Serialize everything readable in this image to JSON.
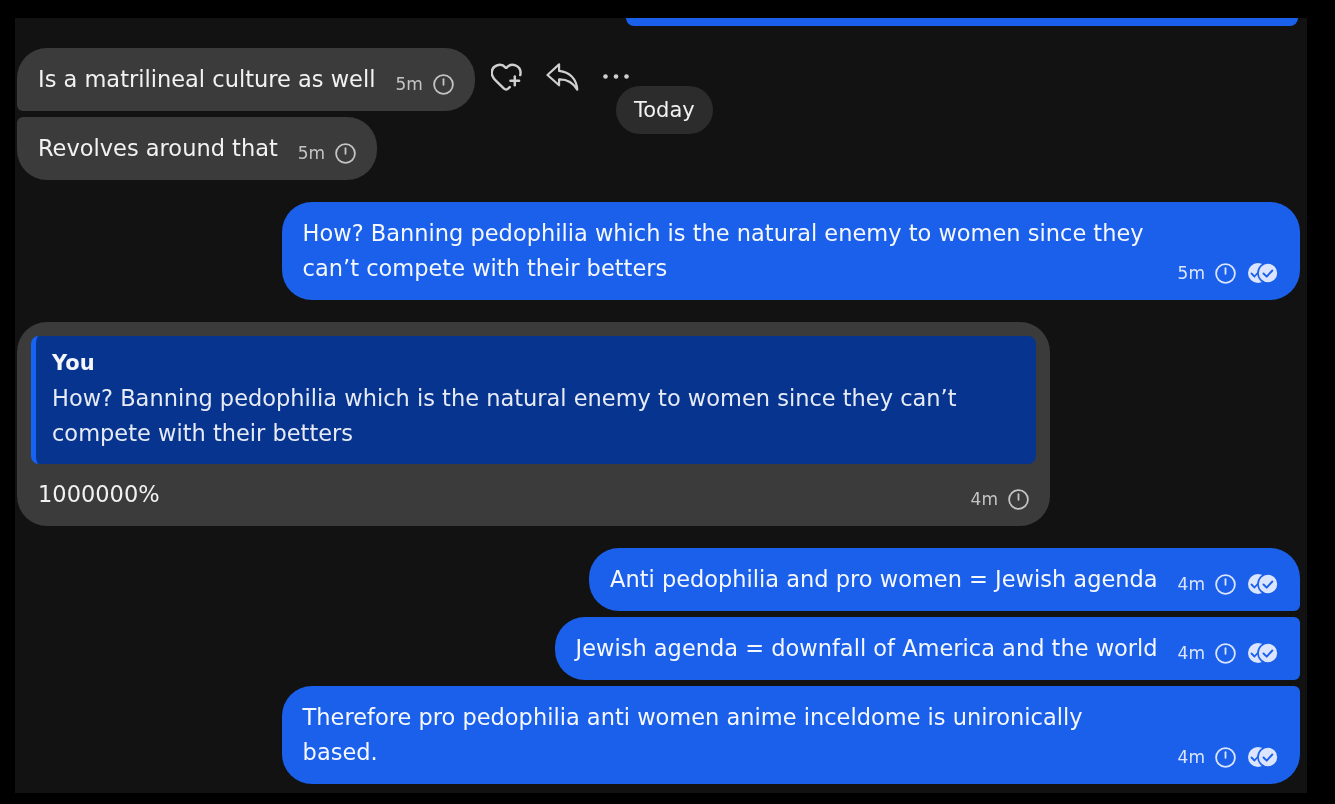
{
  "messages": [
    {
      "kind": "incoming",
      "text": "Is a matrilineal culture as well",
      "time": "5m",
      "hovered": true
    },
    {
      "kind": "incoming",
      "text": "Revolves around that",
      "time": "5m",
      "hovered": false
    },
    {
      "kind": "outgoing",
      "text": "How? Banning pedophilia which is the natural enemy to women since they can’t compete with their betters",
      "time": "5m",
      "read": true,
      "hovered": false
    },
    {
      "kind": "incoming",
      "reply": {
        "author": "You",
        "text": "How? Banning pedophilia which is the natural enemy to women since they can’t compete with their betters"
      },
      "text": "1000000%",
      "time": "4m",
      "hovered": false
    },
    {
      "kind": "outgoing",
      "text": "Anti pedophilia and pro women = Jewish agenda",
      "time": "4m",
      "read": true,
      "hovered": false
    },
    {
      "kind": "outgoing",
      "text": "Jewish agenda = downfall of America and the world",
      "time": "4m",
      "read": true,
      "hovered": false
    },
    {
      "kind": "outgoing",
      "text": "Therefore pro pedophilia anti women anime inceldome is unironically based.",
      "time": "4m",
      "read": true,
      "hovered": false
    }
  ],
  "date_badge": "Today"
}
